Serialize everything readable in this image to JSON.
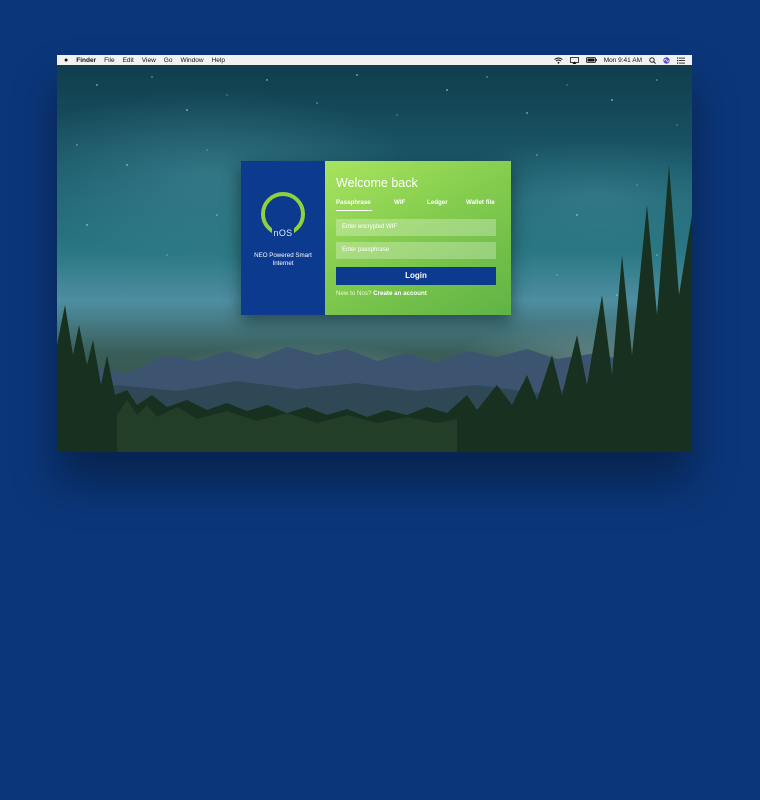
{
  "menubar": {
    "app_name": "Finder",
    "menus": [
      "File",
      "Edit",
      "View",
      "Go",
      "Window",
      "Help"
    ],
    "clock": "Mon 9:41 AM",
    "status_icons": [
      "wifi-icon",
      "airplay-icon",
      "battery-icon",
      "search-icon",
      "siri-icon",
      "notification-list-icon"
    ]
  },
  "login": {
    "logo_text": "nOS",
    "tagline": "NEO Powered Smart Internet",
    "title": "Welcome back",
    "tabs": [
      "Passphrase",
      "WIF",
      "Ledger",
      "Wallet file"
    ],
    "active_tab": "Passphrase",
    "wif_placeholder": "Enter encrypted WIF",
    "passphrase_placeholder": "Enter passphrase",
    "login_button": "Login",
    "signup_prompt": "New to Nos?",
    "signup_link": "Create an account"
  },
  "colors": {
    "page_background": "#0b3679",
    "brand_blue": "#0b3a8f",
    "accent_green": "#8ed23e"
  }
}
